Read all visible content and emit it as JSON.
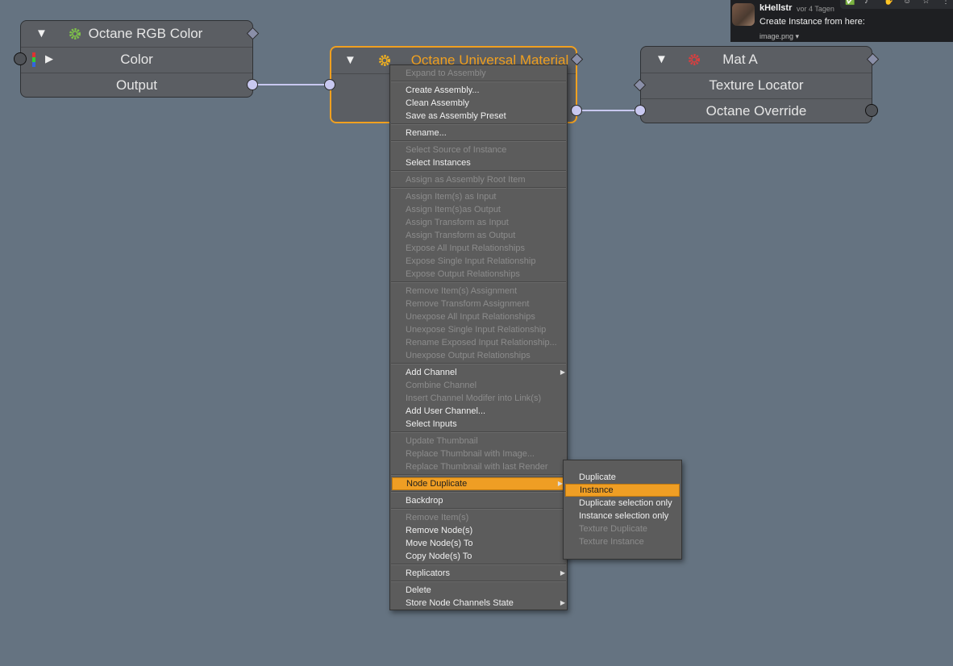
{
  "nodes": {
    "rgb": {
      "title": "Octane RGB Color",
      "rows": [
        "Color",
        "Output"
      ]
    },
    "universal": {
      "title": "Octane Universal Material"
    },
    "mat": {
      "title": "Mat A",
      "rows": [
        "Texture Locator",
        "Octane Override"
      ]
    }
  },
  "colors": {
    "accent": "#ef9e24",
    "background": "#657381",
    "wire": "#c8c8f0"
  },
  "context_menu": {
    "groups": [
      [
        {
          "label": "Expand to Assembly",
          "enabled": false
        }
      ],
      [
        {
          "label": "Create Assembly...",
          "enabled": true
        },
        {
          "label": "Clean Assembly",
          "enabled": true
        },
        {
          "label": "Save as Assembly Preset",
          "enabled": true
        }
      ],
      [
        {
          "label": "Rename...",
          "enabled": true
        }
      ],
      [
        {
          "label": "Select Source of Instance",
          "enabled": false
        },
        {
          "label": "Select Instances",
          "enabled": true
        }
      ],
      [
        {
          "label": "Assign as Assembly Root Item",
          "enabled": false
        }
      ],
      [
        {
          "label": "Assign Item(s) as Input",
          "enabled": false
        },
        {
          "label": "Assign Item(s)as Output",
          "enabled": false
        },
        {
          "label": "Assign Transform as Input",
          "enabled": false
        },
        {
          "label": "Assign Transform as Output",
          "enabled": false
        },
        {
          "label": "Expose All Input Relationships",
          "enabled": false
        },
        {
          "label": "Expose Single Input Relationship",
          "enabled": false
        },
        {
          "label": "Expose Output Relationships",
          "enabled": false
        }
      ],
      [
        {
          "label": "Remove Item(s) Assignment",
          "enabled": false
        },
        {
          "label": "Remove Transform Assignment",
          "enabled": false
        },
        {
          "label": "Unexpose All Input Relationships",
          "enabled": false
        },
        {
          "label": "Unexpose Single Input Relationship",
          "enabled": false
        },
        {
          "label": "Rename Exposed Input Relationship...",
          "enabled": false
        },
        {
          "label": "Unexpose Output Relationships",
          "enabled": false
        }
      ],
      [
        {
          "label": "Add Channel",
          "enabled": true,
          "submenu": true
        },
        {
          "label": "Combine Channel",
          "enabled": false
        },
        {
          "label": "Insert Channel Modifer into Link(s)",
          "enabled": false
        },
        {
          "label": "Add User Channel...",
          "enabled": true
        },
        {
          "label": "Select Inputs",
          "enabled": true
        }
      ],
      [
        {
          "label": "Update Thumbnail",
          "enabled": false
        },
        {
          "label": "Replace Thumbnail with Image...",
          "enabled": false
        },
        {
          "label": "Replace Thumbnail with last Render",
          "enabled": false
        }
      ],
      [
        {
          "label": "Node Duplicate",
          "enabled": true,
          "submenu": true,
          "highlighted": true
        }
      ],
      [
        {
          "label": "Backdrop",
          "enabled": true
        }
      ],
      [
        {
          "label": "Remove Item(s)",
          "enabled": false
        },
        {
          "label": "Remove Node(s)",
          "enabled": true
        },
        {
          "label": "Move Node(s) To",
          "enabled": true
        },
        {
          "label": "Copy Node(s) To",
          "enabled": true
        }
      ],
      [
        {
          "label": "Replicators",
          "enabled": true,
          "submenu": true
        }
      ],
      [
        {
          "label": "Delete",
          "enabled": true
        },
        {
          "label": "Store Node Channels State",
          "enabled": true,
          "submenu": true
        }
      ]
    ]
  },
  "submenu": {
    "items": [
      {
        "label": "Duplicate",
        "enabled": true
      },
      {
        "label": "Instance",
        "enabled": true,
        "highlighted": true
      },
      {
        "label": "Duplicate selection only",
        "enabled": true
      },
      {
        "label": "Instance selection only",
        "enabled": true
      },
      {
        "label": "Texture Duplicate",
        "enabled": false
      },
      {
        "label": "Texture Instance",
        "enabled": false
      }
    ]
  },
  "chat": {
    "user": "kHellstr",
    "time": "vor 4 Tagen",
    "message": "Create Instance from here:",
    "file": "image.png"
  }
}
